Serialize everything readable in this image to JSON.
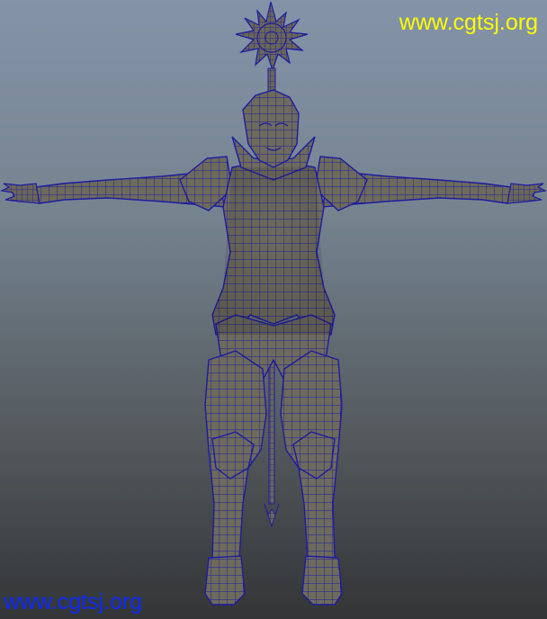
{
  "viewport": {
    "background_top": "#8493a8",
    "background_bottom": "#333536",
    "mesh_fill": "#706b5c",
    "wireframe_color": "#1c1ca0"
  },
  "watermarks": {
    "top_right": "www.cgtsj.org",
    "bottom_left": "www.cgtsj.org",
    "top_color": "#ffff00",
    "bottom_color": "#0d2bff"
  },
  "model": {
    "icons": [
      "sun-halo-icon",
      "character-mesh",
      "staff-prop"
    ]
  }
}
